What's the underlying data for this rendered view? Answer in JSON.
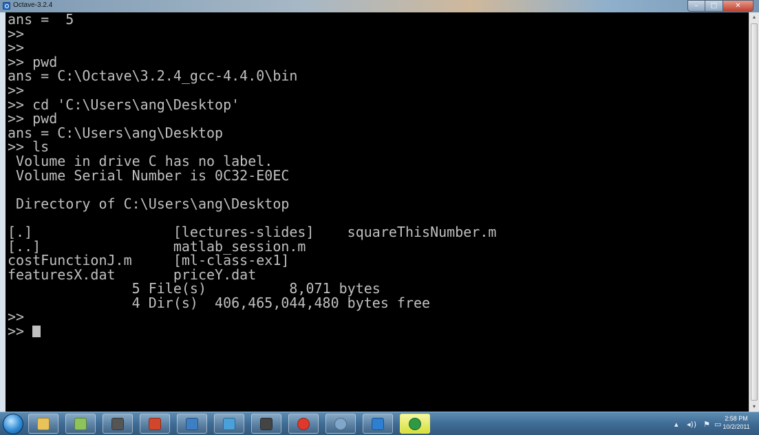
{
  "window": {
    "title": "Octave-3.2.4",
    "minimize_glyph": "–",
    "maximize_glyph": "□",
    "close_glyph": "✕"
  },
  "console": {
    "lines": [
      "ans =  5",
      ">>",
      ">>",
      ">> pwd",
      "ans = C:\\Octave\\3.2.4_gcc-4.4.0\\bin",
      ">>",
      ">> cd 'C:\\Users\\ang\\Desktop'",
      ">> pwd",
      "ans = C:\\Users\\ang\\Desktop",
      ">> ls",
      " Volume in drive C has no label.",
      " Volume Serial Number is 0C32-E0EC",
      "",
      " Directory of C:\\Users\\ang\\Desktop",
      "",
      "[.]                 [lectures-slides]    squareThisNumber.m",
      "[..]                matlab_session.m",
      "costFunctionJ.m     [ml-class-ex1]",
      "featuresX.dat       priceY.dat",
      "               5 File(s)          8,071 bytes",
      "               4 Dir(s)  406,465,044,480 bytes free",
      ">>",
      ">> "
    ]
  },
  "scrollbar": {
    "up_glyph": "▴",
    "down_glyph": "▾"
  },
  "taskbar": {
    "apps": [
      {
        "name": "windows-explorer",
        "color": "#e9c35a"
      },
      {
        "name": "notepad",
        "color": "#8dc35a"
      },
      {
        "name": "cmd",
        "color": "#555555"
      },
      {
        "name": "powerpoint",
        "color": "#d2462c"
      },
      {
        "name": "network",
        "color": "#3e7fc4"
      },
      {
        "name": "connection",
        "color": "#4aa0d8"
      },
      {
        "name": "camera",
        "color": "#444444"
      },
      {
        "name": "chrome",
        "color": "#e0392b"
      },
      {
        "name": "webcam",
        "color": "#7fa7c9"
      },
      {
        "name": "script",
        "color": "#2f7fd0"
      },
      {
        "name": "camtasia",
        "color": "#2e9a44"
      }
    ],
    "active_index": 10,
    "tray": {
      "arrow": "▴",
      "volume": "◂))",
      "flag": "⚑",
      "network": "▭"
    },
    "clock": {
      "time": "2:58 PM",
      "date": "10/2/2011"
    }
  }
}
